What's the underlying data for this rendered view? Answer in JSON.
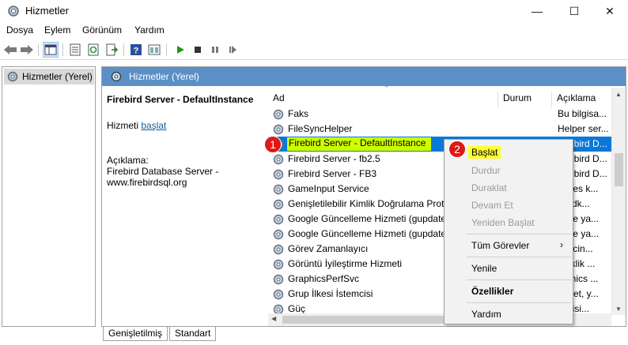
{
  "window": {
    "title": "Hizmetler",
    "minimize": "—",
    "maximize": "☐",
    "close": "✕"
  },
  "menu": [
    "Dosya",
    "Eylem",
    "Görünüm",
    "Yardım"
  ],
  "tree": {
    "root": "Hizmetler (Yerel)"
  },
  "panel": {
    "title": "Hizmetler (Yerel)"
  },
  "details": {
    "service_name": "Firebird Server - DefaultInstance",
    "action_prefix": "Hizmeti ",
    "action_link": "başlat",
    "desc_label": "Açıklama:",
    "desc_line1": "Firebird Database Server -",
    "desc_line2": "www.firebirdsql.org"
  },
  "columns": {
    "name": "Ad",
    "status": "Durum",
    "description": "Açıklama"
  },
  "services": [
    {
      "name": "Faks",
      "status": "",
      "description": "Bu bilgisa..."
    },
    {
      "name": "FileSyncHelper",
      "status": "",
      "description": "Helper ser..."
    },
    {
      "name": "Firebird Server - DefaultInstance",
      "status": "",
      "description": "Firebird D..."
    },
    {
      "name": "Firebird Server - fb2.5",
      "status": "",
      "description": "Firebird D..."
    },
    {
      "name": "Firebird Server - FB3",
      "status": "",
      "description": "Firebird D..."
    },
    {
      "name": "GameInput Service",
      "status": "",
      "description": "...bles k..."
    },
    {
      "name": "Genişletilebilir Kimlik Doğrulama Prot...",
      "status": "",
      "description": "...Sdk..."
    },
    {
      "name": "Google Güncelleme Hizmeti (gupdate)",
      "status": "",
      "description": "...gle ya..."
    },
    {
      "name": "Google Güncelleme Hizmeti (gupdatem)",
      "status": "",
      "description": "...gle ya..."
    },
    {
      "name": "Görev Zamanlayıcı",
      "status": "",
      "description": "...nicin..."
    },
    {
      "name": "Görüntü İyileştirme Hizmeti",
      "status": "",
      "description": "...aklik ..."
    },
    {
      "name": "GraphicsPerfSvc",
      "status": "",
      "description": "...phics ..."
    },
    {
      "name": "Grup İlkesi İstemcisi",
      "status": "",
      "description": "...met, y..."
    },
    {
      "name": "Güç",
      "status": "",
      "description": "...ikisi..."
    }
  ],
  "context_menu": {
    "start": "Başlat",
    "stop": "Durdur",
    "pause": "Duraklat",
    "resume": "Devam Et",
    "restart": "Yeniden Başlat",
    "all_tasks": "Tüm Görevler",
    "refresh": "Yenile",
    "properties": "Özellikler",
    "help": "Yardım"
  },
  "badges": {
    "one": "1",
    "two": "2"
  },
  "tabs": {
    "extended": "Genişletilmiş",
    "standard": "Standart"
  },
  "colors": {
    "selection": "#0a78d7",
    "panel_header": "#5b8fc7",
    "highlight": "#ccff00",
    "badge": "#e01818"
  }
}
